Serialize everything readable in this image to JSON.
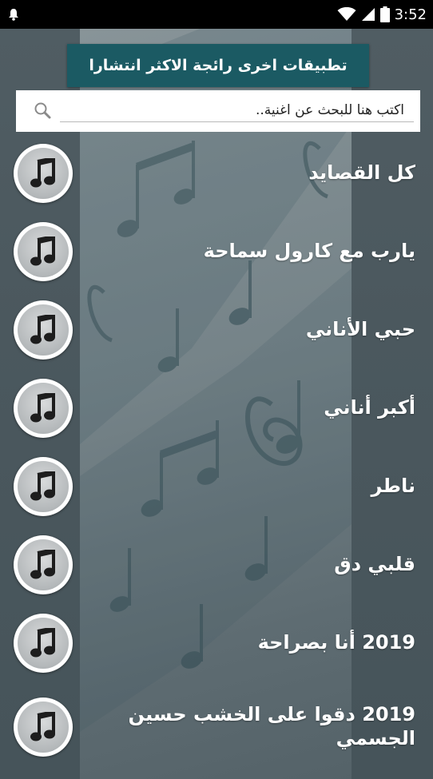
{
  "status_bar": {
    "time": "3:52",
    "icons": [
      "notification-bell-icon",
      "wifi-icon",
      "signal-icon",
      "battery-icon"
    ]
  },
  "header": {
    "more_apps_label": "تطبيقات اخرى رائجة الاكثر انتشارا"
  },
  "search": {
    "placeholder": "اكتب هنا للبحث عن اغنية..",
    "value": ""
  },
  "songs": [
    {
      "title": "كل القصايد",
      "icon": "music-note-icon"
    },
    {
      "title": "يارب مع كارول سماحة",
      "icon": "music-note-icon"
    },
    {
      "title": "حبي الأناني",
      "icon": "music-note-icon"
    },
    {
      "title": "أكبر أناني",
      "icon": "music-note-icon"
    },
    {
      "title": "ناطر",
      "icon": "music-note-icon"
    },
    {
      "title": "قلبي دق",
      "icon": "music-note-icon"
    },
    {
      "title": "2019 أنا بصراحة",
      "icon": "music-note-icon"
    },
    {
      "title": "2019 دقوا على الخشب حسين الجسمي",
      "icon": "music-note-icon"
    }
  ],
  "colors": {
    "status_bar": "#000000",
    "banner": "#1b5a63",
    "background": "#4a5a60",
    "text": "#ffffff"
  }
}
